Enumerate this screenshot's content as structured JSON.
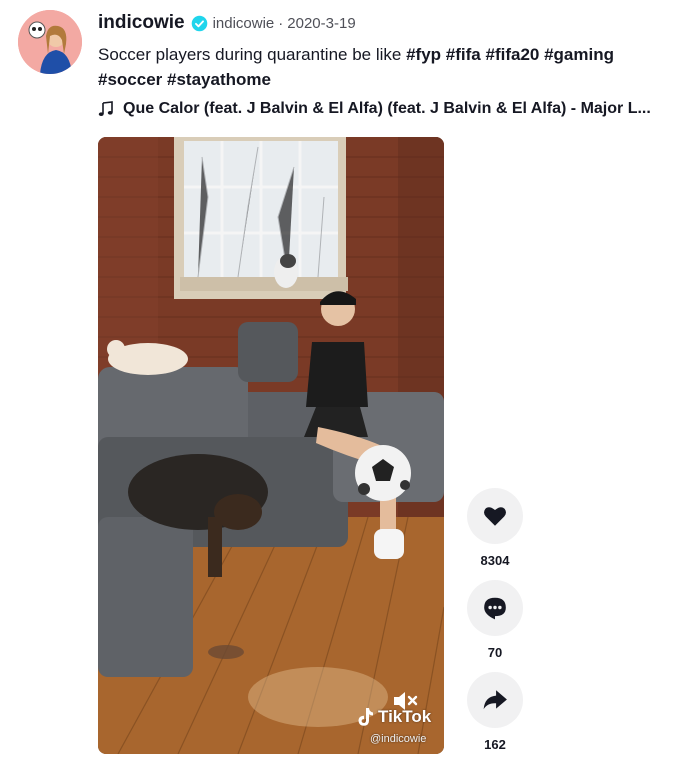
{
  "post": {
    "username": "indicowie",
    "handle": "indicowie",
    "separator": "·",
    "date": "2020-3-19",
    "caption_text": "Soccer players during quarantine be like ",
    "hashtags": [
      "#fyp",
      "#fifa",
      "#fifa20",
      "#gaming",
      "#soccer",
      "#stayathome"
    ],
    "music": "Que Calor (feat. J Balvin & El Alfa) (feat. J Balvin & El Alfa) - Major L..."
  },
  "video": {
    "watermark_brand": "TikTok",
    "watermark_handle": "@indicowie"
  },
  "actions": {
    "likes": "8304",
    "comments": "70",
    "shares": "162"
  },
  "colors": {
    "text": "#161823",
    "secondary": "#4f5058",
    "verified": "#20d5ec",
    "action_bg": "#f1f1f2"
  },
  "icons": {
    "verified": "verified-badge-icon",
    "music": "music-note-icon",
    "like": "heart-icon",
    "comment": "comment-icon",
    "share": "share-arrow-icon",
    "mute": "muted-speaker-icon",
    "tiktok": "tiktok-logo-icon"
  }
}
